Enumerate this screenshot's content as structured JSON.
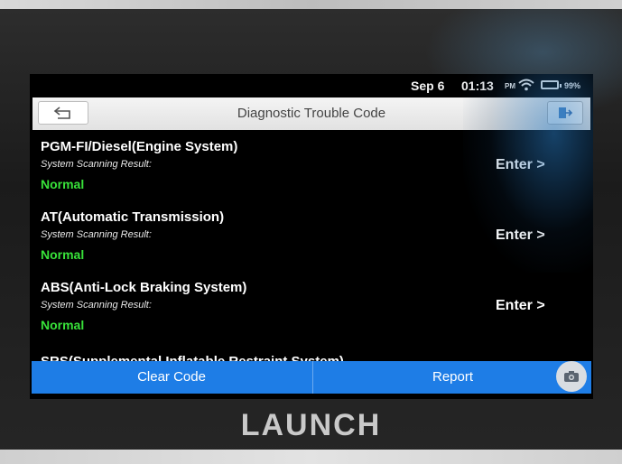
{
  "status_bar": {
    "date": "Sep 6",
    "time": "01:13",
    "ampm": "PM",
    "battery": "99%",
    "wifi_icon": "wifi-icon",
    "battery_icon": "battery-icon"
  },
  "header": {
    "title": "Diagnostic Trouble Code",
    "back_icon": "back-arrow-icon",
    "exit_icon": "exit-icon"
  },
  "systems": [
    {
      "name": "PGM-FI/Diesel(Engine System)",
      "sub_label": "System Scanning Result:",
      "status": "Normal",
      "enter_label": "Enter >"
    },
    {
      "name": "AT(Automatic Transmission)",
      "sub_label": "System Scanning Result:",
      "status": "Normal",
      "enter_label": "Enter >"
    },
    {
      "name": "ABS(Anti-Lock Braking System)",
      "sub_label": "System Scanning Result:",
      "status": "Normal",
      "enter_label": "Enter >"
    },
    {
      "name": "SRS(Supplemental Inflatable Restraint System)"
    }
  ],
  "actions": {
    "clear_label": "Clear Code",
    "report_label": "Report",
    "camera_icon": "camera-icon"
  },
  "brand": "LAUNCH",
  "colors": {
    "status_normal": "#38e23a",
    "action_bar": "#1e7de6",
    "title_bar": "#e8e8e8"
  }
}
